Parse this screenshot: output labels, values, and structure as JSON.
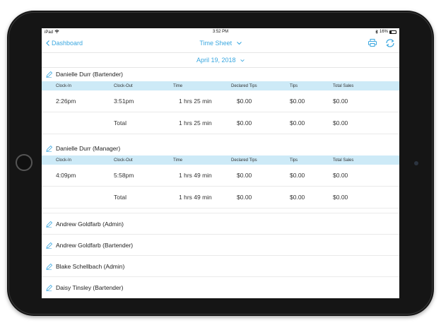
{
  "status_bar": {
    "device": "iPad",
    "time": "3:52 PM",
    "battery": "16%"
  },
  "nav": {
    "back_label": "Dashboard",
    "title": "Time Sheet"
  },
  "date": "April 19, 2018",
  "columns": [
    "Clock-In",
    "Clock-Out",
    "Time",
    "Declared Tips",
    "Tips",
    "Total Sales"
  ],
  "sections": [
    {
      "name": "Danielle Durr (Bartender)",
      "rows": [
        {
          "clock_in": "2:26pm",
          "clock_out": "3:51pm",
          "time": "1 hrs 25 min",
          "declared_tips": "$0.00",
          "tips": "$0.00",
          "total_sales": "$0.00"
        }
      ],
      "total": {
        "label": "Total",
        "time": "1 hrs 25 min",
        "declared_tips": "$0.00",
        "tips": "$0.00",
        "total_sales": "$0.00"
      }
    },
    {
      "name": "Danielle Durr (Manager)",
      "rows": [
        {
          "clock_in": "4:09pm",
          "clock_out": "5:58pm",
          "time": "1 hrs 49 min",
          "declared_tips": "$0.00",
          "tips": "$0.00",
          "total_sales": "$0.00"
        }
      ],
      "total": {
        "label": "Total",
        "time": "1 hrs 49 min",
        "declared_tips": "$0.00",
        "tips": "$0.00",
        "total_sales": "$0.00"
      }
    }
  ],
  "employees": [
    "Andrew Goldfarb (Admin)",
    "Andrew Goldfarb (Bartender)",
    "Blake Schellbach (Admin)",
    "Daisy Tinsley (Bartender)"
  ],
  "colors": {
    "accent": "#3aa7e0",
    "header_row": "#cdeaf7",
    "bezel": "#151515"
  },
  "icons": [
    "wifi-icon",
    "bluetooth-icon",
    "battery-icon",
    "chevron-left-icon",
    "chevron-down-icon",
    "printer-icon",
    "refresh-icon",
    "pencil-icon"
  ]
}
